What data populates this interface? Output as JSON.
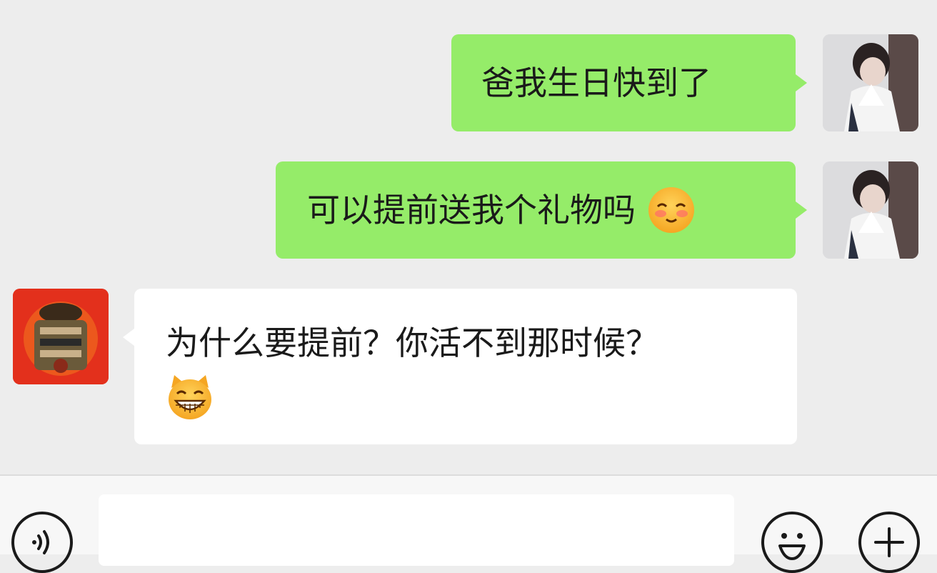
{
  "messages": [
    {
      "sender": "me",
      "text": "爸我生日快到了",
      "emoji": ""
    },
    {
      "sender": "me",
      "text": "可以提前送我个礼物吗",
      "emoji": "blushing-face"
    },
    {
      "sender": "dad",
      "text_line1": "为什么要提前？你活不到那时候？",
      "emoji": "grinning-cat-face"
    }
  ],
  "colors": {
    "sent_bubble": "#95ec69",
    "received_bubble": "#ffffff",
    "background": "#ededed",
    "toolbar": "#f7f7f7"
  },
  "toolbar": {
    "voice_icon": "voice-icon",
    "emoji_icon": "emoji-icon",
    "plus_icon": "plus-icon"
  }
}
